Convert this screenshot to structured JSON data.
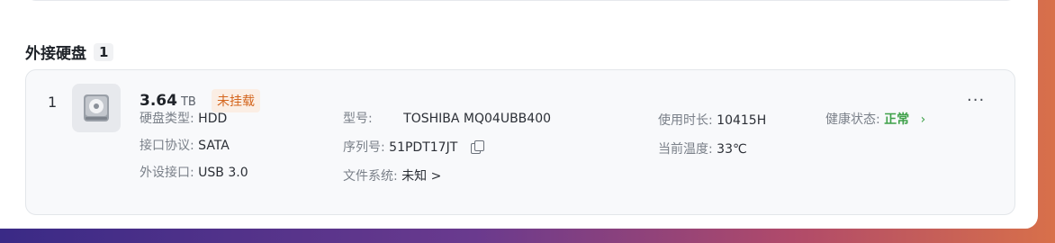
{
  "section": {
    "title": "外接硬盘",
    "count": "1"
  },
  "disk": {
    "index": "1",
    "size_value": "3.64",
    "size_unit": "TB",
    "status_badge": "未挂载",
    "more_label": "···",
    "disk_type_label": "硬盘类型:",
    "disk_type_value": "HDD",
    "interface_label": "接口协议:",
    "interface_value": "SATA",
    "port_label": "外设接口:",
    "port_value": "USB 3.0",
    "model_label": "型号:",
    "model_value": "TOSHIBA MQ04UBB400",
    "serial_label": "序列号:",
    "serial_value": "51PDT17JT",
    "fs_label": "文件系统:",
    "fs_value": "未知 >",
    "usage_time_label": "使用时长:",
    "usage_time_value": "10415H",
    "temp_label": "当前温度:",
    "temp_value": "33℃",
    "health_label": "健康状态:",
    "health_value": "正常",
    "health_link": "›"
  },
  "colors": {
    "ok": "#3fa14a",
    "warning": "#d4661e"
  },
  "icons": [
    "hard-disk-icon",
    "copy-icon",
    "more-icon",
    "chevron-right-icon"
  ]
}
